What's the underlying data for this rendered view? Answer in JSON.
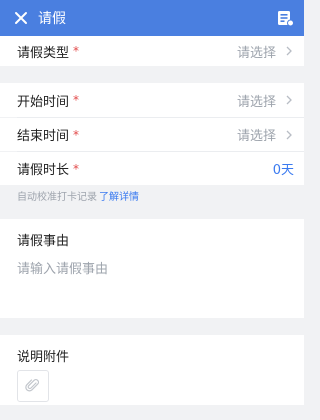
{
  "header": {
    "title": "请假",
    "close_icon": "close-icon",
    "menu_icon": "document-list-icon",
    "accent": "#4a7fe0"
  },
  "form": {
    "leave_type": {
      "label": "请假类型",
      "required": "*",
      "value": "请选择"
    },
    "start_time": {
      "label": "开始时间",
      "required": "*",
      "value": "请选择"
    },
    "end_time": {
      "label": "结束时间",
      "required": "*",
      "value": "请选择"
    },
    "duration": {
      "label": "请假时长",
      "required": "*",
      "value": "0天"
    },
    "hint": {
      "text": "自动校准打卡记录",
      "link": "了解详情"
    },
    "reason": {
      "label": "请假事由",
      "placeholder": "请输入请假事由"
    },
    "attachment": {
      "label": "说明附件",
      "icon": "paperclip-icon"
    }
  }
}
